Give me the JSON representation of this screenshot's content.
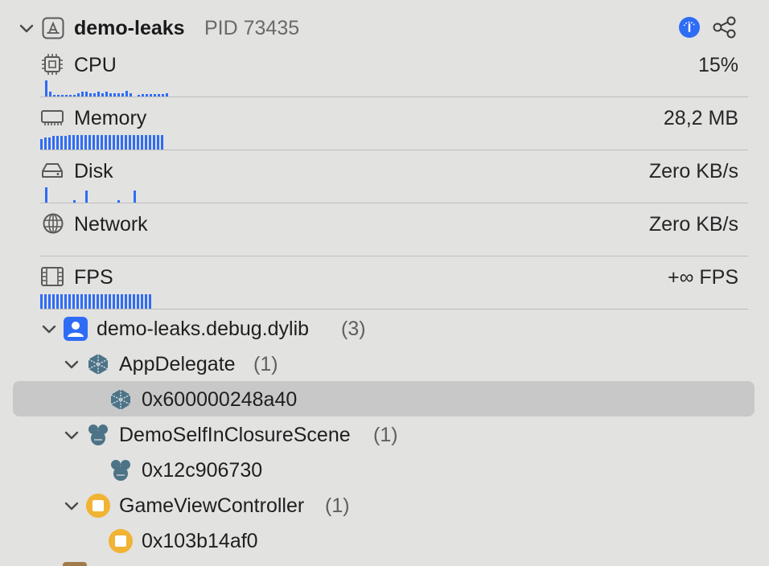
{
  "process": {
    "name": "demo-leaks",
    "pid_label": "PID 73435",
    "info_icon": "info-icon",
    "graph_icon": "graph-icon"
  },
  "gauges": [
    {
      "key": "cpu",
      "label": "CPU",
      "value": "15%",
      "icon": "cpu-icon",
      "history": [
        0.9,
        0.25,
        0.1,
        0.1,
        0.1,
        0.1,
        0.1,
        0.1,
        0.2,
        0.25,
        0.25,
        0.2,
        0.2,
        0.25,
        0.2,
        0.25,
        0.2,
        0.2,
        0.2,
        0.2,
        0.3,
        0.2,
        0,
        0.1,
        0.15,
        0.15,
        0.15,
        0.15,
        0.15,
        0.15,
        0.2
      ]
    },
    {
      "key": "memory",
      "label": "Memory",
      "value": "28,2 MB",
      "icon": "memory-icon",
      "history": [
        0.6,
        0.7,
        0.7,
        0.75,
        0.75,
        0.75,
        0.75,
        0.8,
        0.8,
        0.8,
        0.8,
        0.8,
        0.8,
        0.8,
        0.8,
        0.8,
        0.8,
        0.8,
        0.8,
        0.8,
        0.8,
        0.8,
        0.8,
        0.8,
        0.8,
        0.8,
        0.8,
        0.8,
        0.8,
        0.8,
        0.8
      ]
    },
    {
      "key": "disk",
      "label": "Disk",
      "value": "Zero KB/s",
      "icon": "disk-icon",
      "history": [
        0.85,
        0,
        0,
        0,
        0,
        0,
        0,
        0.15,
        0,
        0,
        0.7,
        0,
        0,
        0,
        0,
        0,
        0,
        0,
        0.15,
        0,
        0,
        0,
        0.7,
        0,
        0,
        0,
        0,
        0,
        0,
        0,
        0
      ]
    },
    {
      "key": "network",
      "label": "Network",
      "value": "Zero KB/s",
      "icon": "globe-icon",
      "history": []
    },
    {
      "key": "fps",
      "label": "FPS",
      "value": "+∞ FPS",
      "icon": "film-icon",
      "history": [
        0.8,
        0.8,
        0.8,
        0.8,
        0.8,
        0.8,
        0.8,
        0.8,
        0.8,
        0.8,
        0.8,
        0.8,
        0.8,
        0.8,
        0.8,
        0.8,
        0.8,
        0.8,
        0.8,
        0.8,
        0.8,
        0.8,
        0.8,
        0.8,
        0.8,
        0.8,
        0.8,
        0.8
      ]
    }
  ],
  "tree": {
    "module": {
      "name": "demo-leaks.debug.dylib",
      "count": "(3)"
    },
    "classes": [
      {
        "name": "AppDelegate",
        "count": "(1)",
        "instance": "0x600000248a40",
        "icon": "cube-icon"
      },
      {
        "name": "DemoSelfInClosureScene",
        "count": "(1)",
        "instance": "0x12c906730",
        "icon": "cluster-icon"
      },
      {
        "name": "GameViewController",
        "count": "(1)",
        "instance": "0x103b14af0",
        "icon": "square-badge-icon"
      }
    ]
  },
  "colors": {
    "bar": "#2f6cf6",
    "accent_blue": "#2f6cf6",
    "badge_yellow": "#f1b333",
    "selection": "#c8c8c8",
    "cube": "#4d7387"
  }
}
